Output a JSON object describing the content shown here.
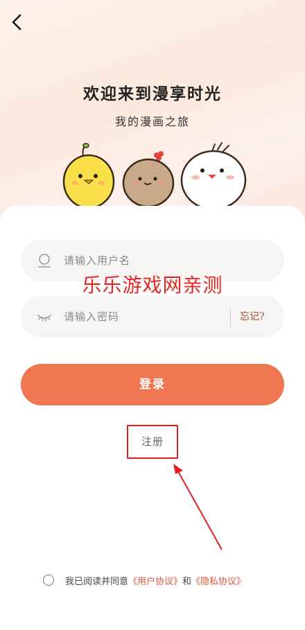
{
  "header": {
    "back_icon": "chevron-left-icon"
  },
  "welcome": {
    "title": "欢迎来到漫享时光",
    "subtitle": "我的漫画之旅"
  },
  "form": {
    "username": {
      "placeholder": "请输入用户名",
      "value": "",
      "icon": "user-icon"
    },
    "password": {
      "placeholder": "请输入密码",
      "value": "",
      "icon": "eye-closed-icon",
      "forgot_label": "忘记?"
    },
    "login_label": "登录",
    "register_label": "注册"
  },
  "watermark": "乐乐游戏网亲测",
  "agreement": {
    "prefix": "我已阅读并同意",
    "user_agreement": "《用户协议》",
    "conjunction": "和",
    "privacy_policy": "《隐私协议》",
    "checked": false
  },
  "colors": {
    "accent": "#ee7650",
    "link": "#e2563a",
    "highlight_red": "#e02020"
  }
}
